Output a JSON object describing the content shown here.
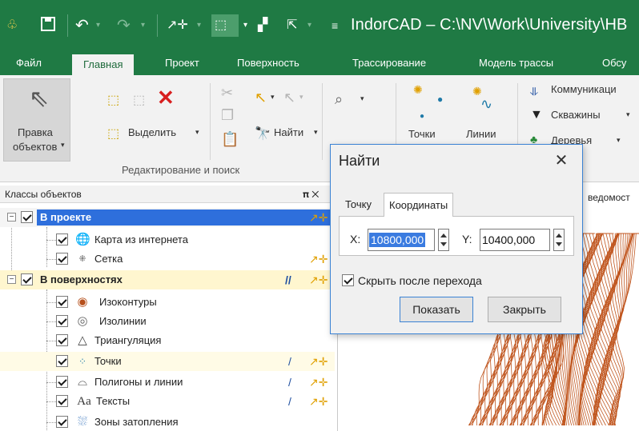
{
  "titlebar": {
    "title": "IndorCAD – C:\\NV\\Work\\University\\HB",
    "bg_color": "#1f7a44",
    "icons": [
      "app-logo-icon",
      "save-icon",
      "undo-icon",
      "redo-icon",
      "add-point-icon",
      "select-tool-icon",
      "multi-select-icon",
      "pointer-icon",
      "quick-access-dropdown-icon"
    ]
  },
  "ribbon": {
    "tabs": [
      "Файл",
      "Главная",
      "Проект",
      "Поверхность",
      "Трассирование",
      "Модель трассы",
      "Обсу"
    ],
    "active_tab": "Главная",
    "edit_objects_label_1": "Правка",
    "edit_objects_label_2": "объектов",
    "select_label": "Выделить",
    "find_label": "Найти",
    "group_label": "Редактирование и поиск",
    "points_label": "Точки",
    "lines_label": "Линии",
    "communications_label": "Коммуникаци",
    "wells_label": "Скважины",
    "trees_label": "Деревья"
  },
  "panel": {
    "title": "Классы объектов",
    "pin": "𝛑 ✕",
    "groups": [
      {
        "label": "В проекте",
        "items": [
          "Карта из интернета",
          "Сетка"
        ]
      },
      {
        "label": "В поверхностях",
        "items": [
          "Изоконтуры",
          "Изолинии",
          "Триангуляция",
          "Точки",
          "Полигоны и линии",
          "Тексты",
          "Зоны затопления"
        ]
      }
    ]
  },
  "map": {
    "tab_label": "ведомост",
    "contour_color": "#c0561f"
  },
  "dialog": {
    "title": "Найти",
    "close": "✕",
    "tabs": [
      "Точку",
      "Координаты"
    ],
    "active_tab": "Координаты",
    "x_label": "X:",
    "x_value": "10800,000",
    "y_label": "Y:",
    "y_value": "10400,000",
    "hide_after_jump_label": "Скрыть после перехода",
    "hide_after_jump_checked": true,
    "show_button": "Показать",
    "close_button": "Закрыть",
    "accent_color": "#3a82d4"
  }
}
